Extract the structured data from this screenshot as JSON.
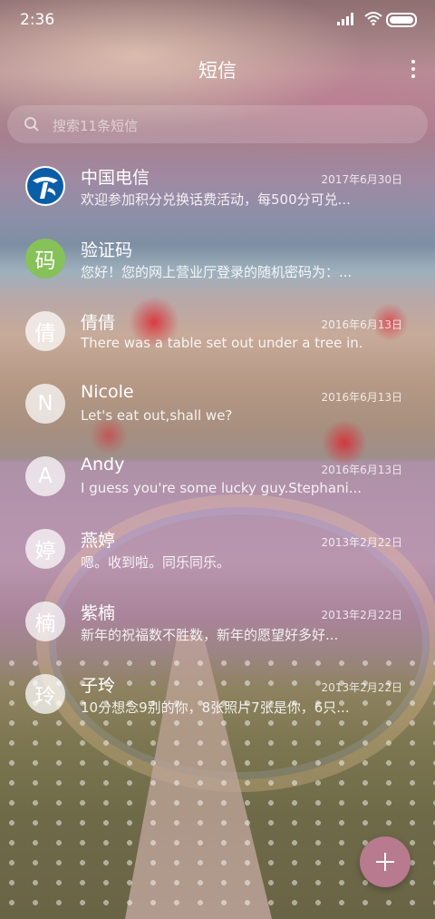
{
  "status_bar": {
    "time": "2:36"
  },
  "header": {
    "title": "短信"
  },
  "search": {
    "placeholder": "搜索11条短信"
  },
  "conversations": [
    {
      "name": "中国电信",
      "date": "2017年6月30日",
      "preview": "欢迎参加积分兑换话费活动，每500分可兑...",
      "avatar_icon": "china-telecom-logo"
    },
    {
      "name": "验证码",
      "date": "",
      "preview": "您好！您的网上营业厅登录的随机密码为：...",
      "avatar_text": "码",
      "avatar_color": "#86c15a"
    },
    {
      "name": "倩倩",
      "date": "2016年6月13日",
      "preview": "There was a table set out under a tree in...",
      "avatar_text": "倩"
    },
    {
      "name": "Nicole",
      "date": "2016年6月13日",
      "preview": "Let's eat out,shall we?",
      "avatar_text": "N"
    },
    {
      "name": "Andy",
      "date": "2016年6月13日",
      "preview": "I guess you're some lucky guy.Stephani...",
      "avatar_text": "A"
    },
    {
      "name": "燕婷",
      "date": "2013年2月22日",
      "preview": "嗯。收到啦。同乐同乐。",
      "avatar_text": "婷"
    },
    {
      "name": "紫楠",
      "date": "2013年2月22日",
      "preview": "新年的祝福数不胜数，新年的愿望好多好...",
      "avatar_text": "楠"
    },
    {
      "name": "子玲",
      "date": "2013年2月22日",
      "preview": "10分想念9别的你，8张照片7张是你，6只...",
      "avatar_text": "玲"
    }
  ],
  "fab": {
    "icon": "plus-icon"
  },
  "colors": {
    "fab": "#b87a8e",
    "verify_avatar": "#86c15a",
    "telecom_blue": "#0a5ea8"
  }
}
